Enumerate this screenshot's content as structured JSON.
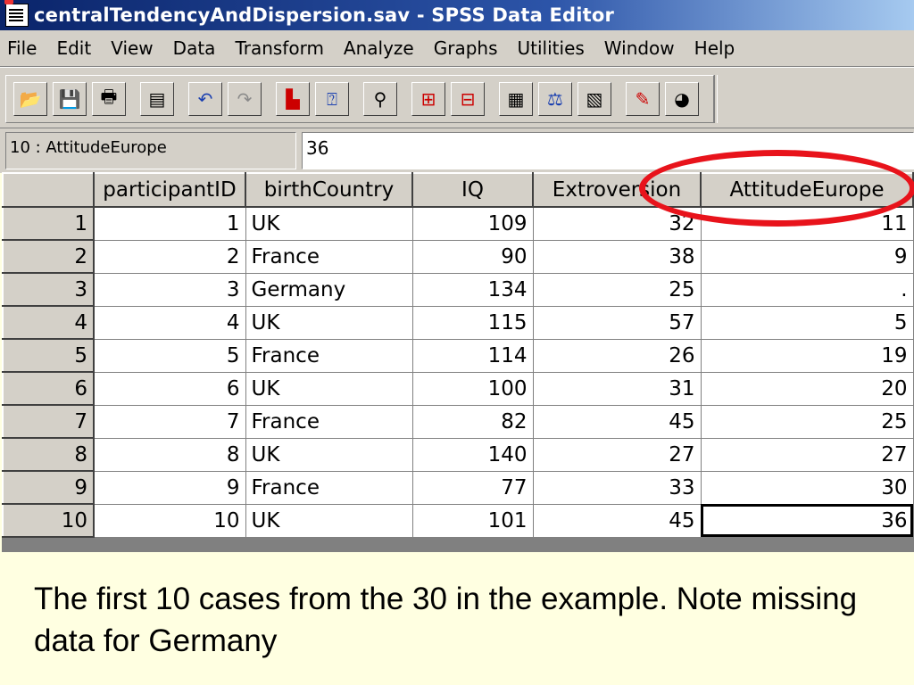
{
  "window": {
    "title": "centralTendencyAndDispersion.sav - SPSS Data Editor"
  },
  "menu": [
    "File",
    "Edit",
    "View",
    "Data",
    "Transform",
    "Analyze",
    "Graphs",
    "Utilities",
    "Window",
    "Help"
  ],
  "toolbar": {
    "buttons": [
      {
        "name": "open-file",
        "glyph": "📂"
      },
      {
        "name": "save",
        "glyph": "💾"
      },
      {
        "name": "print",
        "glyph": "🖶"
      },
      {
        "name": "dialog-recall",
        "glyph": "▤"
      },
      {
        "name": "undo",
        "glyph": "↶"
      },
      {
        "name": "redo",
        "glyph": "↷"
      },
      {
        "name": "goto-chart",
        "glyph": "▙"
      },
      {
        "name": "variables",
        "glyph": "⍰"
      },
      {
        "name": "find",
        "glyph": "⚲"
      },
      {
        "name": "insert-cases",
        "glyph": "⊞"
      },
      {
        "name": "insert-variable",
        "glyph": "⊟"
      },
      {
        "name": "split-file",
        "glyph": "▦"
      },
      {
        "name": "weight-cases",
        "glyph": "⚖"
      },
      {
        "name": "select-cases",
        "glyph": "▧"
      },
      {
        "name": "value-labels",
        "glyph": "✎"
      },
      {
        "name": "use-sets",
        "glyph": "◕"
      }
    ]
  },
  "cell_editor": {
    "reference": "10 : AttitudeEurope",
    "value": "36"
  },
  "table": {
    "columns": [
      "participantID",
      "birthCountry",
      "IQ",
      "Extroversion",
      "AttitudeEurope"
    ],
    "rows": [
      {
        "row": "1",
        "participantID": "1",
        "birthCountry": "UK",
        "IQ": "109",
        "Extroversion": "32",
        "AttitudeEurope": "11"
      },
      {
        "row": "2",
        "participantID": "2",
        "birthCountry": "France",
        "IQ": "90",
        "Extroversion": "38",
        "AttitudeEurope": "9"
      },
      {
        "row": "3",
        "participantID": "3",
        "birthCountry": "Germany",
        "IQ": "134",
        "Extroversion": "25",
        "AttitudeEurope": "."
      },
      {
        "row": "4",
        "participantID": "4",
        "birthCountry": "UK",
        "IQ": "115",
        "Extroversion": "57",
        "AttitudeEurope": "5"
      },
      {
        "row": "5",
        "participantID": "5",
        "birthCountry": "France",
        "IQ": "114",
        "Extroversion": "26",
        "AttitudeEurope": "19"
      },
      {
        "row": "6",
        "participantID": "6",
        "birthCountry": "UK",
        "IQ": "100",
        "Extroversion": "31",
        "AttitudeEurope": "20"
      },
      {
        "row": "7",
        "participantID": "7",
        "birthCountry": "France",
        "IQ": "82",
        "Extroversion": "45",
        "AttitudeEurope": "25"
      },
      {
        "row": "8",
        "participantID": "8",
        "birthCountry": "UK",
        "IQ": "140",
        "Extroversion": "27",
        "AttitudeEurope": "27"
      },
      {
        "row": "9",
        "participantID": "9",
        "birthCountry": "France",
        "IQ": "77",
        "Extroversion": "33",
        "AttitudeEurope": "30"
      },
      {
        "row": "10",
        "participantID": "10",
        "birthCountry": "UK",
        "IQ": "101",
        "Extroversion": "45",
        "AttitudeEurope": "36"
      }
    ]
  },
  "annotation": {
    "color": "#e8131b"
  },
  "caption": "The first 10 cases from the 30 in the example. Note missing data for Germany"
}
